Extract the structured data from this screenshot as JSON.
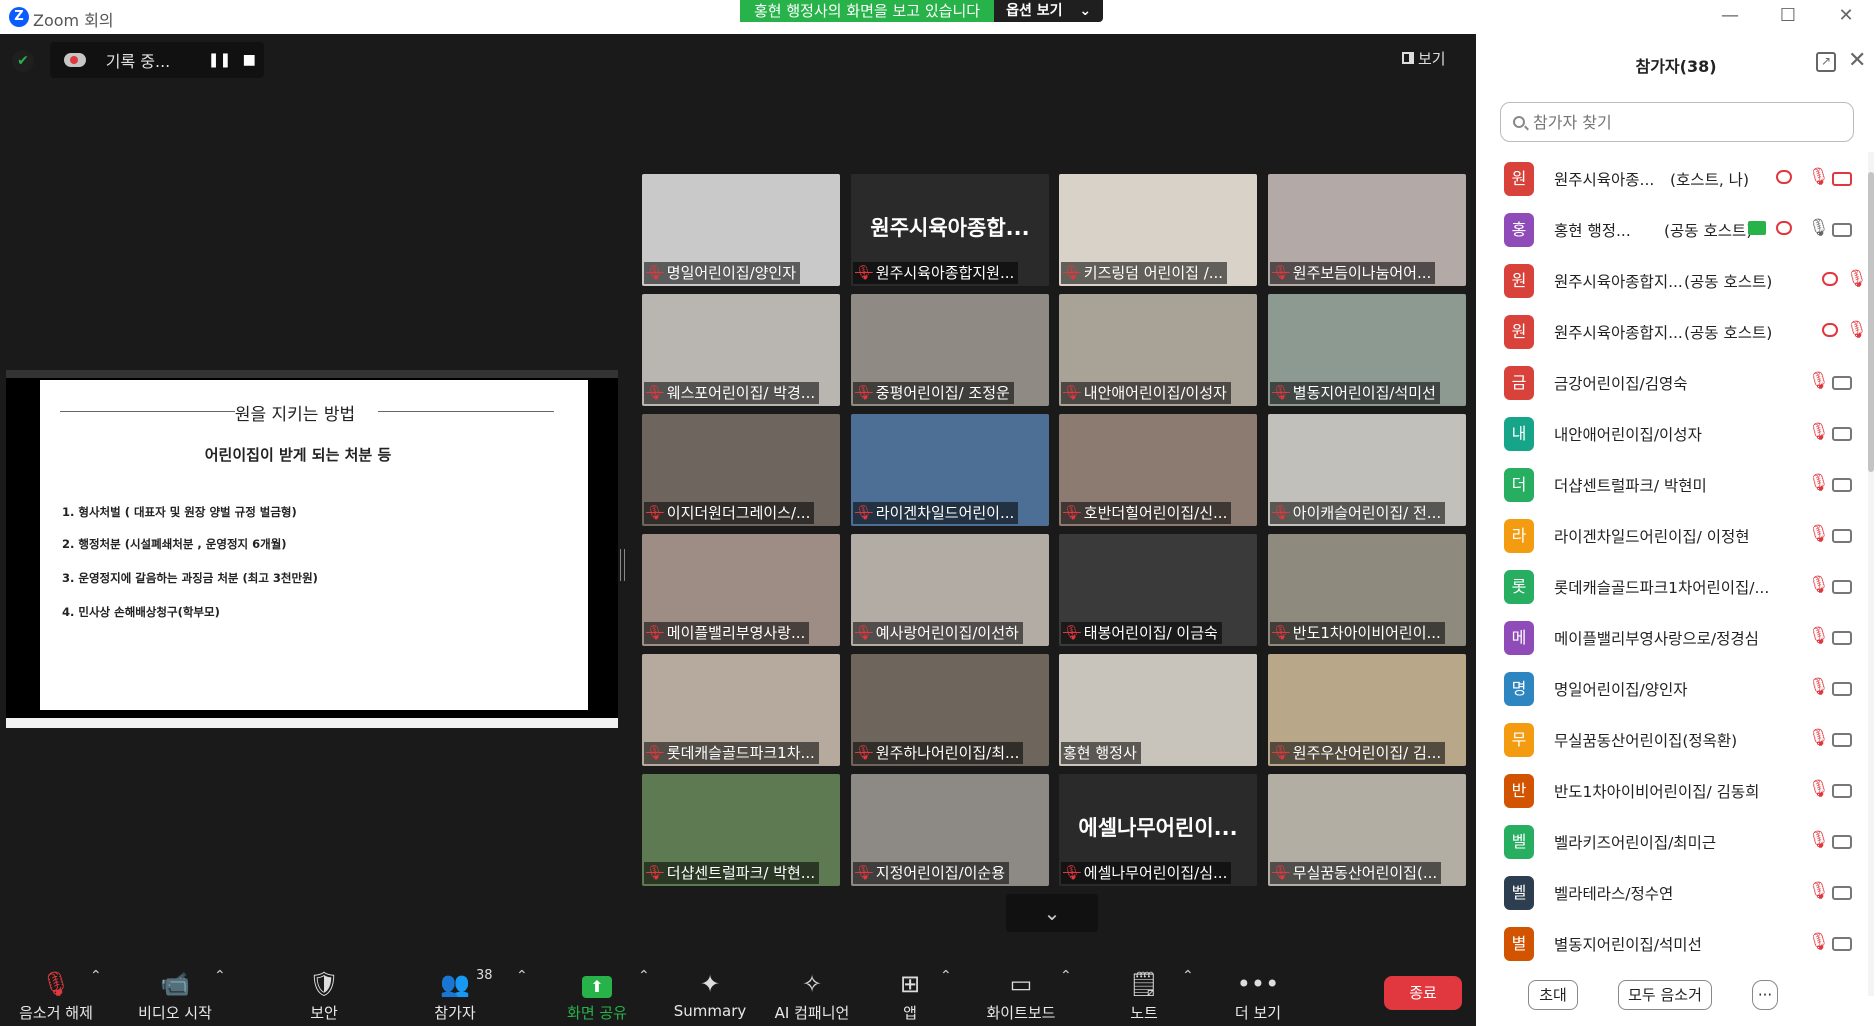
{
  "window": {
    "title": "Zoom 회의",
    "logo": "Z"
  },
  "share_banner": {
    "status": "홍현 행정사의 화면을 보고 있습니다",
    "options": "옵션 보기",
    "chevron": "⌄"
  },
  "recording": {
    "label": "기록 중...",
    "pause": "❚❚",
    "stop": "■"
  },
  "view_button": {
    "label": "보기"
  },
  "slide": {
    "title": "원을 지키는 방법",
    "subtitle": "어린이집이 받게 되는 처분 등",
    "items": [
      "1. 형사처벌 ( 대표자 및 원장 양벌 규정 벌금형)",
      "2. 행정처분 (시설폐쇄처분 , 운영정지 6개월)",
      "3. 운영정지에 갈음하는 과징금 처분 (최고 3천만원)",
      "4. 민사상 손해배상청구(학부모)"
    ]
  },
  "tiles": [
    {
      "name": "명일어린이집/양인자",
      "bg": "#c9c9c9",
      "muted": true
    },
    {
      "name": "원주시육아종합지원...",
      "big": "원주시육아종합...",
      "bg": "#2a2a2a",
      "muted": true
    },
    {
      "name": "키즈링덤 어린이집 /...",
      "bg": "#d8d2c8",
      "muted": true
    },
    {
      "name": "원주보듬이나눔어어...",
      "bg": "#b3a9a6",
      "muted": true
    },
    {
      "name": "웨스포어린이집/ 박경...",
      "bg": "#b9b6b2",
      "muted": true
    },
    {
      "name": "중평어린이집/ 조정운",
      "bg": "#8f8a83",
      "muted": true
    },
    {
      "name": "내안애어린이집/이성자",
      "bg": "#a9a297",
      "muted": true
    },
    {
      "name": "별동지어린이집/석미선",
      "bg": "#8d9a92",
      "muted": true
    },
    {
      "name": "이지더원더그레이스/...",
      "bg": "#6e655f",
      "muted": true
    },
    {
      "name": "라이겐차일드어린이...",
      "bg": "#4d6f96",
      "muted": true
    },
    {
      "name": "호반더힐어린이집/신...",
      "bg": "#8b7b71",
      "muted": true
    },
    {
      "name": "아이캐슬어린이집/ 전...",
      "bg": "#c1c0bb",
      "muted": true
    },
    {
      "name": "메이플밸리부영사랑...",
      "bg": "#9d8d84",
      "muted": true
    },
    {
      "name": "예사랑어린이집/이선하",
      "bg": "#b3aca4",
      "muted": true
    },
    {
      "name": "태봉어린이집/ 이금숙",
      "bg": "#3a3a3a",
      "muted": true
    },
    {
      "name": "반도1차아이비어린이...",
      "bg": "#8f8a7e",
      "muted": true
    },
    {
      "name": "롯데캐슬골드파크1차...",
      "bg": "#b5aa9d",
      "muted": true
    },
    {
      "name": "원주하나어린이집/최...",
      "bg": "#6e655c",
      "muted": true
    },
    {
      "name": "홍현 행정사",
      "bg": "#c9c4bb",
      "muted": false,
      "active": true
    },
    {
      "name": "원주우산어린이집/ 김...",
      "bg": "#b8a788",
      "muted": true
    },
    {
      "name": "더샵센트럴파크/ 박현...",
      "bg": "#5e7a52",
      "muted": true
    },
    {
      "name": "지정어린이집/이순용",
      "bg": "#8d8a86",
      "muted": true
    },
    {
      "name": "에셀나무어린이집/심...",
      "big": "에셀나무어린이...",
      "bg": "#2a2a2a",
      "muted": true
    },
    {
      "name": "무실꿈동산어린이집(...",
      "bg": "#b2aea4",
      "muted": true
    }
  ],
  "grid_expand": "⌄",
  "toolbar": {
    "unmute": "음소거 해제",
    "start_video": "비디오 시작",
    "security": "보안",
    "participants": "참가자",
    "participants_count": "38",
    "share_screen": "화면 공유",
    "summary": "Summary",
    "ai_companion": "AI 컴패니언",
    "apps": "앱",
    "whiteboard": "화이트보드",
    "notes": "노트",
    "more": "더 보기",
    "end": "종료"
  },
  "panel": {
    "title": "참가자(38)",
    "search_placeholder": "참가자 찾기",
    "participants": [
      {
        "initial": "원",
        "name": "원주시육아종...",
        "role": "(호스트, 나)",
        "color": "#d9423b",
        "cloud": true,
        "cam_off": true,
        "mic_on": false
      },
      {
        "initial": "홍",
        "name": "홍현 행정...",
        "role": "(공동 호스트)",
        "color": "#8f4bb7",
        "sharing": true,
        "cloud": true,
        "mic_on": true
      },
      {
        "initial": "원",
        "name": "원주시육아종합지...",
        "role": "(공동 호스트)",
        "color": "#d9423b",
        "cloud": true,
        "mic_on": false,
        "no_cam": true
      },
      {
        "initial": "원",
        "name": "원주시육아종합지...",
        "role": "(공동 호스트)",
        "color": "#d9423b",
        "cloud": true,
        "mic_on": false,
        "no_cam": true
      },
      {
        "initial": "금",
        "name": "금강어린이집/김영숙",
        "color": "#d9423b",
        "mic_on": false
      },
      {
        "initial": "내",
        "name": "내안애어린이집/이성자",
        "color": "#17a589",
        "mic_on": false
      },
      {
        "initial": "더",
        "name": "더샵센트럴파크/ 박현미",
        "color": "#27ae60",
        "mic_on": false
      },
      {
        "initial": "라",
        "name": "라이겐차일드어린이집/ 이정현",
        "color": "#f39c12",
        "mic_on": false
      },
      {
        "initial": "롯",
        "name": "롯데캐슬골드파크1차어린이집/...",
        "color": "#27ae60",
        "mic_on": false
      },
      {
        "initial": "메",
        "name": "메이플밸리부영사랑으로/정경심",
        "color": "#8f4bb7",
        "mic_on": false
      },
      {
        "initial": "명",
        "name": "명일어린이집/양인자",
        "color": "#2e86c1",
        "mic_on": false
      },
      {
        "initial": "무",
        "name": "무실꿈동산어린이집(정옥환)",
        "color": "#f39c12",
        "mic_on": false
      },
      {
        "initial": "반",
        "name": "반도1차아이비어린이집/ 김동희",
        "color": "#d35400",
        "mic_on": false
      },
      {
        "initial": "벨",
        "name": "벨라키즈어린이집/최미근",
        "color": "#27ae60",
        "mic_on": false
      },
      {
        "initial": "벨",
        "name": "벨라테라스/정수연",
        "color": "#2c3e50",
        "mic_on": false
      },
      {
        "initial": "별",
        "name": "별동지어린이집/석미선",
        "color": "#d35400",
        "mic_on": false
      }
    ],
    "invite": "초대",
    "mute_all": "모두 음소거",
    "more": "···"
  }
}
